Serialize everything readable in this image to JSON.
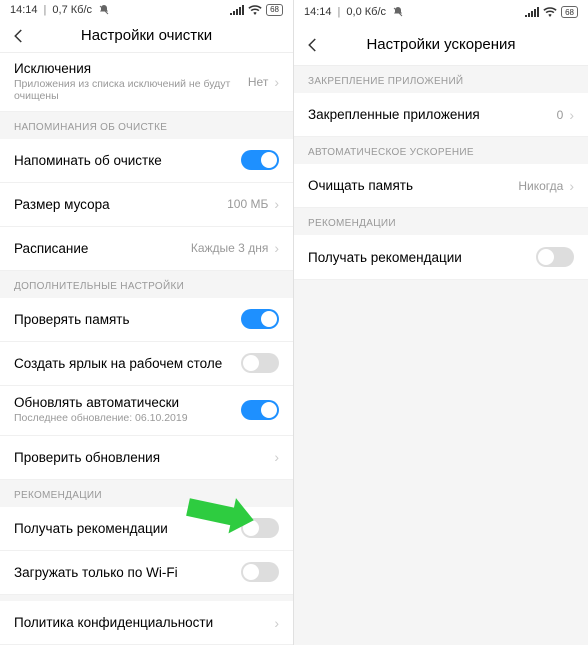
{
  "left": {
    "status": {
      "time": "14:14",
      "net_speed": "0,7 Кб/с",
      "battery": "68"
    },
    "header": {
      "title": "Настройки очистки"
    },
    "exclusions": {
      "title": "Исключения",
      "sub": "Приложения из списка исключений не будут очищены",
      "value": "Нет"
    },
    "section_reminders": "НАПОМИНАНИЯ ОБ ОЧИСТКЕ",
    "remind": {
      "title": "Напоминать об очистке"
    },
    "trash_size": {
      "title": "Размер мусора",
      "value": "100 МБ"
    },
    "schedule": {
      "title": "Расписание",
      "value": "Каждые 3 дня"
    },
    "section_extra": "ДОПОЛНИТЕЛЬНЫЕ НАСТРОЙКИ",
    "check_memory": {
      "title": "Проверять память"
    },
    "shortcut": {
      "title": "Создать ярлык на рабочем столе"
    },
    "auto_update": {
      "title": "Обновлять автоматически",
      "sub": "Последнее обновление: 06.10.2019"
    },
    "check_updates": {
      "title": "Проверить обновления"
    },
    "section_recs": "РЕКОМЕНДАЦИИ",
    "recv_recs": {
      "title": "Получать рекомендации"
    },
    "wifi_only": {
      "title": "Загружать только по Wi-Fi"
    },
    "privacy": {
      "title": "Политика конфиденциальности"
    }
  },
  "right": {
    "status": {
      "time": "14:14",
      "net_speed": "0,0 Кб/с",
      "battery": "68"
    },
    "header": {
      "title": "Настройки ускорения"
    },
    "section_pinned": "ЗАКРЕПЛЕНИЕ ПРИЛОЖЕНИЙ",
    "pinned_apps": {
      "title": "Закрепленные приложения",
      "value": "0"
    },
    "section_auto": "АВТОМАТИЧЕСКОЕ УСКОРЕНИЕ",
    "clear_mem": {
      "title": "Очищать память",
      "value": "Никогда"
    },
    "section_recs": "РЕКОМЕНДАЦИИ",
    "recv_recs": {
      "title": "Получать рекомендации"
    }
  }
}
